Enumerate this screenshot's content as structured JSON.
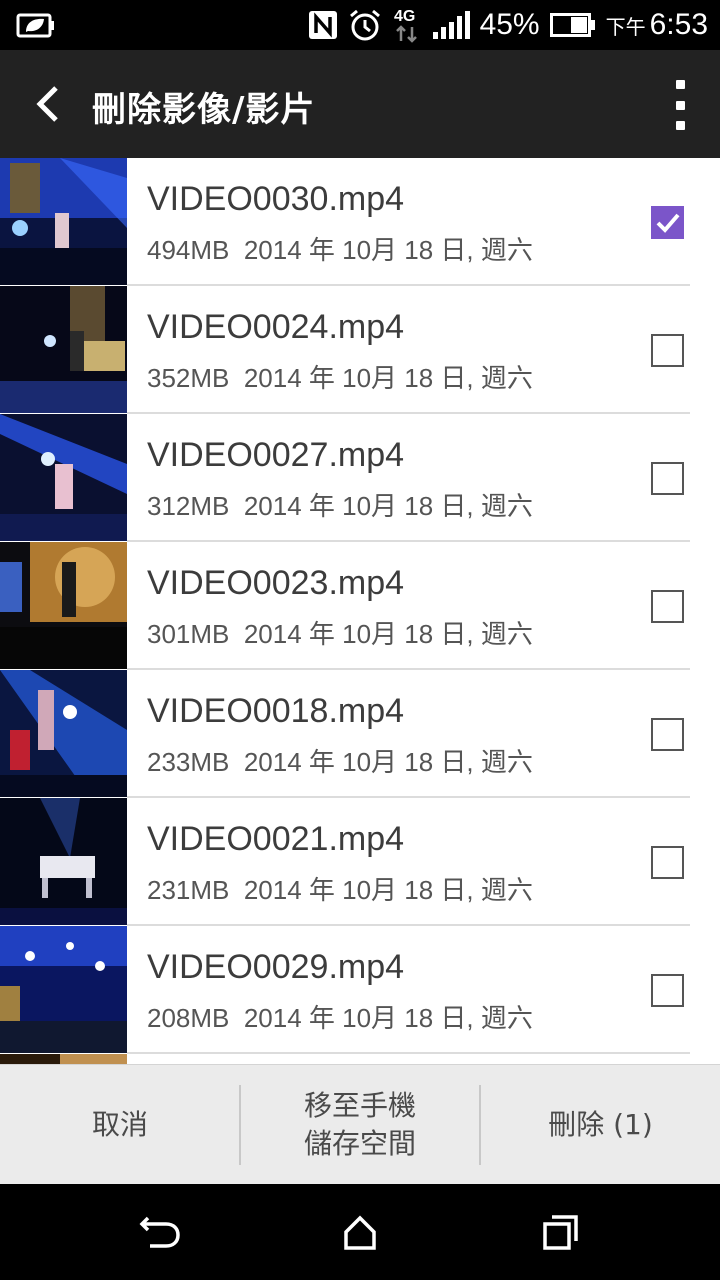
{
  "status_bar": {
    "battery_percent": "45%",
    "network": "4G",
    "time_prefix": "下午",
    "time": "6:53",
    "icons": [
      "leaf-battery-saver-icon",
      "nfc-icon",
      "alarm-icon",
      "4g-data-icon",
      "signal-icon",
      "battery-icon"
    ]
  },
  "app_bar": {
    "title": "刪除影像/影片",
    "back_icon": "chevron-left-icon",
    "overflow_icon": "more-vert-icon"
  },
  "files": [
    {
      "name": "VIDEO0030.mp4",
      "meta": "494MB  2014 年 10月 18 日, 週六",
      "checked": true
    },
    {
      "name": "VIDEO0024.mp4",
      "meta": "352MB  2014 年 10月 18 日, 週六",
      "checked": false
    },
    {
      "name": "VIDEO0027.mp4",
      "meta": "312MB  2014 年 10月 18 日, 週六",
      "checked": false
    },
    {
      "name": "VIDEO0023.mp4",
      "meta": "301MB  2014 年 10月 18 日, 週六",
      "checked": false
    },
    {
      "name": "VIDEO0018.mp4",
      "meta": "233MB  2014 年 10月 18 日, 週六",
      "checked": false
    },
    {
      "name": "VIDEO0021.mp4",
      "meta": "231MB  2014 年 10月 18 日, 週六",
      "checked": false
    },
    {
      "name": "VIDEO0029.mp4",
      "meta": "208MB  2014 年 10月 18 日, 週六",
      "checked": false
    }
  ],
  "actions": {
    "cancel": "取消",
    "move": "移至手機\n儲存空間",
    "delete": "刪除 (1)"
  },
  "colors": {
    "accent": "#7b55c9",
    "app_bar": "#222222",
    "action_bar": "#ebebeb"
  }
}
